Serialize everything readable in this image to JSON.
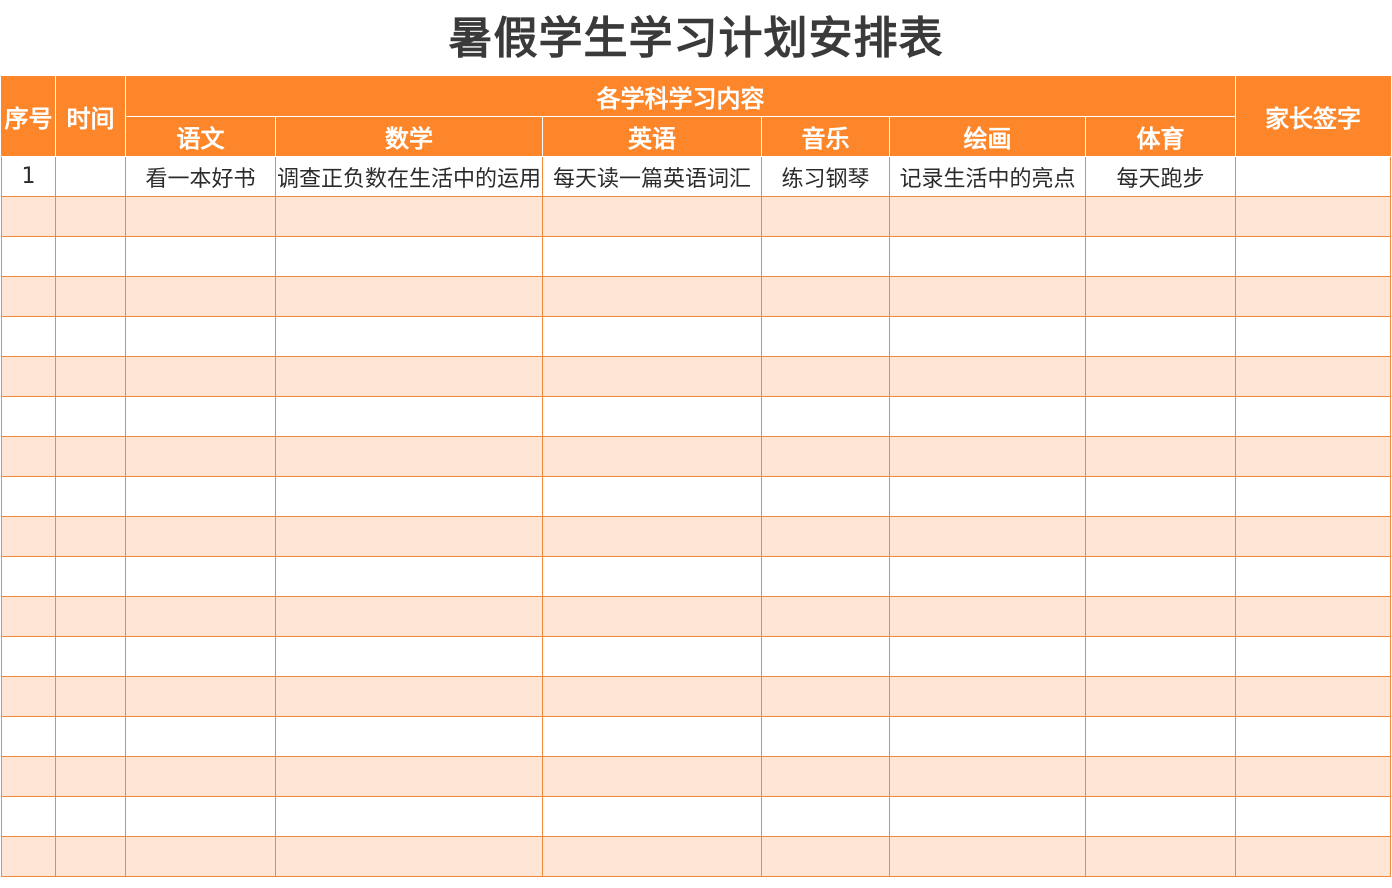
{
  "title": "暑假学生学习计划安排表",
  "header": {
    "index": "序号",
    "time": "时间",
    "subject_group": "各学科学习内容",
    "subjects": [
      "语文",
      "数学",
      "英语",
      "音乐",
      "绘画",
      "体育"
    ],
    "parent_signature": "家长签字"
  },
  "rows": [
    {
      "index": "1",
      "time": "",
      "cells": [
        "看一本好书",
        "调查正负数在生活中的运用",
        "每天读一篇英语词汇",
        "练习钢琴",
        "记录生活中的亮点",
        "每天跑步"
      ],
      "signature": ""
    }
  ],
  "empty_row_count": 17,
  "colors": {
    "header_bg": "#fd862a",
    "alt_row_bg": "#fee5d6",
    "grid_line": "#f08a3c",
    "title_text": "#3a3a3a"
  }
}
